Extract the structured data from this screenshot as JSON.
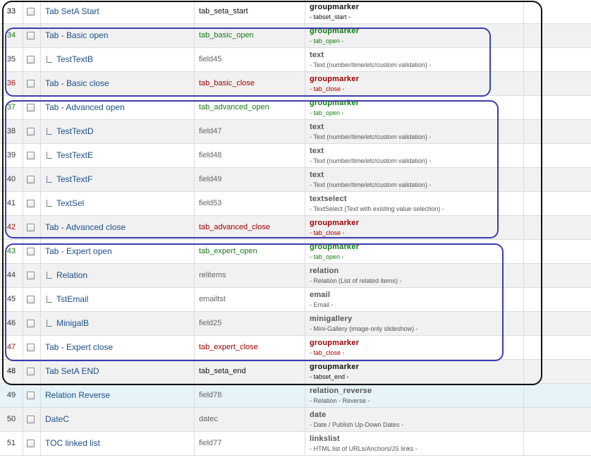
{
  "rows": [
    {
      "num": "33",
      "title": "Tab SetA Start",
      "child": false,
      "field": "tab_seta_start",
      "type": "groupmarker",
      "desc": "- tabset_start -",
      "tone": "black"
    },
    {
      "num": "34",
      "title": "Tab - Basic open",
      "child": false,
      "field": "tab_basic_open",
      "type": "groupmarker",
      "desc": "- tab_open -",
      "tone": "green"
    },
    {
      "num": "35",
      "title": "TestTextB",
      "child": true,
      "field": "field45",
      "type": "text",
      "desc": "- Text (number/time/etc/custom validation) -",
      "tone": "plain"
    },
    {
      "num": "36",
      "title": "Tab - Basic close",
      "child": false,
      "field": "tab_basic_close",
      "type": "groupmarker",
      "desc": "- tab_close -",
      "tone": "red"
    },
    {
      "num": "37",
      "title": "Tab - Advanced open",
      "child": false,
      "field": "tab_advanced_open",
      "type": "groupmarker",
      "desc": "- tab_open -",
      "tone": "green"
    },
    {
      "num": "38",
      "title": "TestTextD",
      "child": true,
      "field": "field47",
      "type": "text",
      "desc": "- Text (number/time/etc/custom validation) -",
      "tone": "plain"
    },
    {
      "num": "39",
      "title": "TestTextE",
      "child": true,
      "field": "field48",
      "type": "text",
      "desc": "- Text (number/time/etc/custom validation) -",
      "tone": "plain"
    },
    {
      "num": "40",
      "title": "TestTextF",
      "child": true,
      "field": "field49",
      "type": "text",
      "desc": "- Text (number/time/etc/custom validation) -",
      "tone": "plain"
    },
    {
      "num": "41",
      "title": "TextSel",
      "child": true,
      "field": "field53",
      "type": "textselect",
      "desc": "- TextSelect (Text with existing value selection) -",
      "tone": "plain"
    },
    {
      "num": "42",
      "title": "Tab - Advanced close",
      "child": false,
      "field": "tab_advanced_close",
      "type": "groupmarker",
      "desc": "- tab_close -",
      "tone": "red"
    },
    {
      "num": "43",
      "title": "Tab - Expert open",
      "child": false,
      "field": "tab_expert_open",
      "type": "groupmarker",
      "desc": "- tab_open -",
      "tone": "green"
    },
    {
      "num": "44",
      "title": "Relation",
      "child": true,
      "field": "relitems",
      "type": "relation",
      "desc": "- Relation (List of related items) -",
      "tone": "plain"
    },
    {
      "num": "45",
      "title": "TstEmail",
      "child": true,
      "field": "emailtst",
      "type": "email",
      "desc": "- Email -",
      "tone": "plain"
    },
    {
      "num": "46",
      "title": "MinigalB",
      "child": true,
      "field": "field25",
      "type": "minigallery",
      "desc": "- Mini-Gallery (image-only slideshow) -",
      "tone": "plain"
    },
    {
      "num": "47",
      "title": "Tab - Expert close",
      "child": false,
      "field": "tab_expert_close",
      "type": "groupmarker",
      "desc": "- tab_close -",
      "tone": "red"
    },
    {
      "num": "48",
      "title": "Tab SetA END",
      "child": false,
      "field": "tab_seta_end",
      "type": "groupmarker",
      "desc": "- tabset_end -",
      "tone": "black"
    },
    {
      "num": "49",
      "title": "Relation Reverse",
      "child": false,
      "field": "field78",
      "type": "relation_reverse",
      "desc": "- Relation - Reverse -",
      "tone": "plain"
    },
    {
      "num": "50",
      "title": "DateC",
      "child": false,
      "field": "datec",
      "type": "date",
      "desc": "- Date / Publish Up-Down Dates -",
      "tone": "plain"
    },
    {
      "num": "51",
      "title": "TOC linked list",
      "child": false,
      "field": "field77",
      "type": "linkslist",
      "desc": "- HTML list of URLs/Anchors/JS links -",
      "tone": "plain"
    }
  ]
}
